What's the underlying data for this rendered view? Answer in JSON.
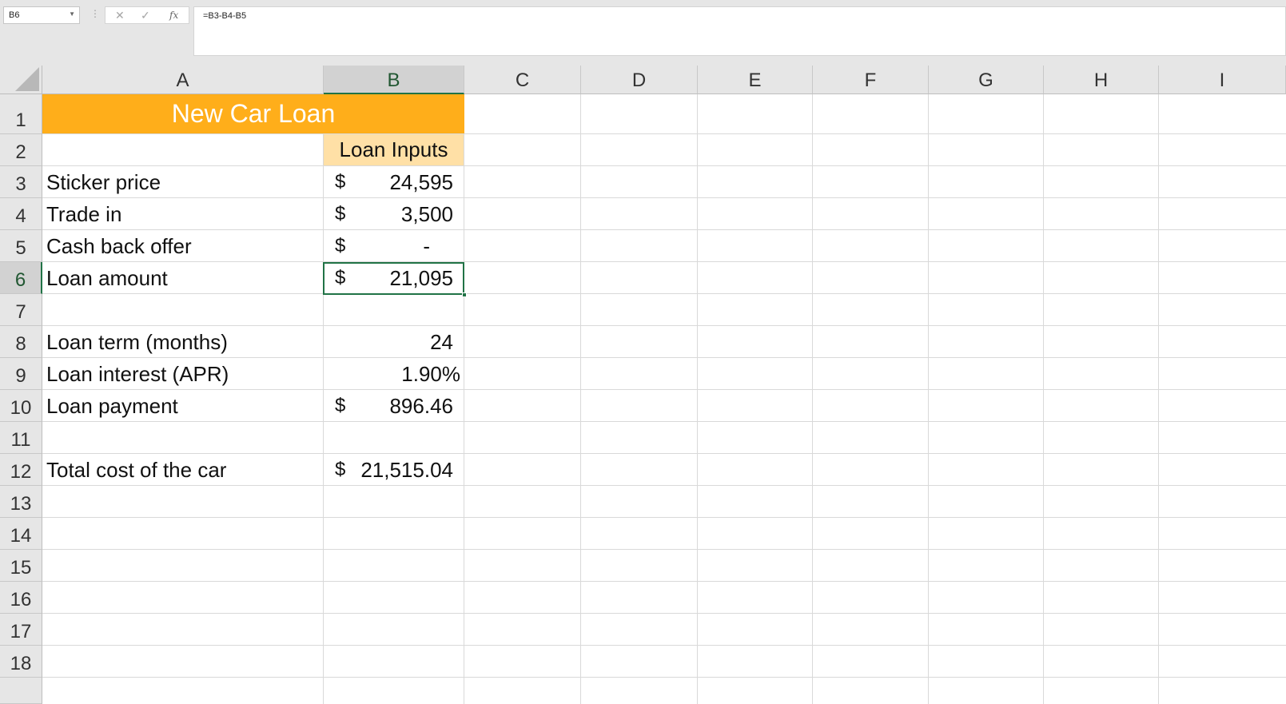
{
  "formula_bar": {
    "name_box": "B6",
    "formula": "=B3-B4-B5",
    "cancel_icon": "✕",
    "enter_icon": "✓",
    "fx_icon": "fx"
  },
  "columns": [
    "A",
    "B",
    "C",
    "D",
    "E",
    "F",
    "G",
    "H",
    "I"
  ],
  "rows": [
    "1",
    "2",
    "3",
    "4",
    "5",
    "6",
    "7",
    "8",
    "9",
    "10",
    "11",
    "12",
    "13",
    "14",
    "15",
    "16",
    "17",
    "18"
  ],
  "selected_cell": "B6",
  "cells": {
    "A1": "New Car Loan",
    "B2": "Loan Inputs",
    "A3": "Sticker price",
    "B3": {
      "currency": "$",
      "value": "24,595"
    },
    "A4": "Trade in",
    "B4": {
      "currency": "$",
      "value": "3,500"
    },
    "A5": "Cash back offer",
    "B5": {
      "currency": "$",
      "value": "-"
    },
    "A6": "Loan amount",
    "B6": {
      "currency": "$",
      "value": "21,095"
    },
    "A8": "Loan term (months)",
    "B8": {
      "value": "24"
    },
    "A9": "Loan interest (APR)",
    "B9": {
      "value": "1.90%"
    },
    "A10": "Loan payment",
    "B10": {
      "currency": "$",
      "value": "896.46"
    },
    "A12": "Total cost of the car",
    "B12": {
      "currency": "$",
      "value": "21,515.04"
    }
  },
  "colors": {
    "title_fill": "#ffae1a",
    "inputs_header_fill": "#ffe0a6",
    "selection": "#217346"
  }
}
